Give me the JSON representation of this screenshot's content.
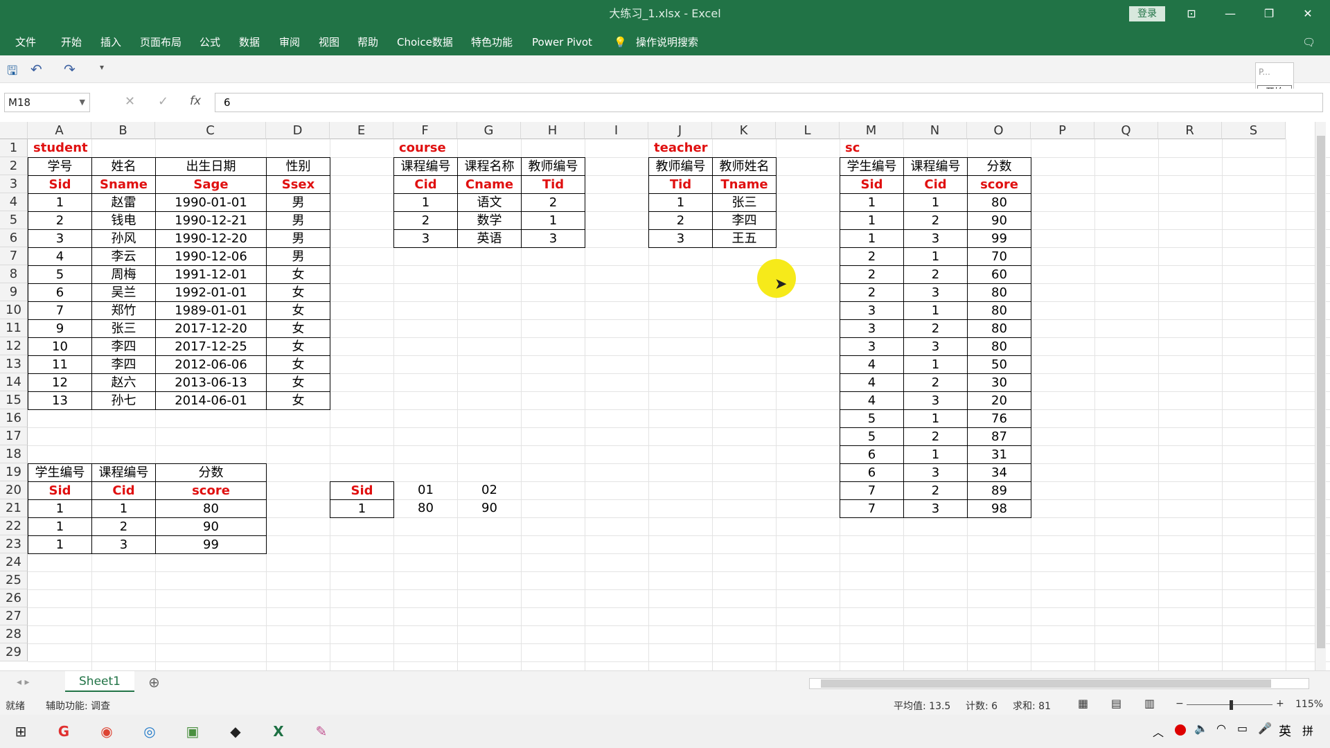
{
  "window": {
    "title": "大练习_1.xlsx - Excel",
    "login": "登录"
  },
  "menu": [
    "文件",
    "开始",
    "插入",
    "页面布局",
    "公式",
    "数据",
    "审阅",
    "视图",
    "帮助",
    "Choice数据",
    "特色功能",
    "Power Pivot",
    "操作说明搜索"
  ],
  "formula": {
    "namebox": "M18",
    "value": "6"
  },
  "mini": {
    "label": "P...",
    "button": "开始"
  },
  "columns": [
    "A",
    "B",
    "C",
    "D",
    "E",
    "F",
    "G",
    "H",
    "I",
    "J",
    "K",
    "L",
    "M",
    "N",
    "O",
    "P",
    "Q",
    "R",
    "S"
  ],
  "rows": [
    "1",
    "2",
    "3",
    "4",
    "5",
    "6",
    "7",
    "8",
    "9",
    "10",
    "11",
    "12",
    "13",
    "14",
    "15",
    "16",
    "17",
    "18",
    "19",
    "20",
    "21",
    "22",
    "23",
    "24",
    "25",
    "26",
    "27",
    "28",
    "29"
  ],
  "student": {
    "label": "student",
    "headers_cn": [
      "学号",
      "姓名",
      "出生日期",
      "性别"
    ],
    "headers_en": [
      "Sid",
      "Sname",
      "Sage",
      "Ssex"
    ],
    "rows": [
      [
        "1",
        "赵雷",
        "1990-01-01",
        "男"
      ],
      [
        "2",
        "钱电",
        "1990-12-21",
        "男"
      ],
      [
        "3",
        "孙风",
        "1990-12-20",
        "男"
      ],
      [
        "4",
        "李云",
        "1990-12-06",
        "男"
      ],
      [
        "5",
        "周梅",
        "1991-12-01",
        "女"
      ],
      [
        "6",
        "吴兰",
        "1992-01-01",
        "女"
      ],
      [
        "7",
        "郑竹",
        "1989-01-01",
        "女"
      ],
      [
        "9",
        "张三",
        "2017-12-20",
        "女"
      ],
      [
        "10",
        "李四",
        "2017-12-25",
        "女"
      ],
      [
        "11",
        "李四",
        "2012-06-06",
        "女"
      ],
      [
        "12",
        "赵六",
        "2013-06-13",
        "女"
      ],
      [
        "13",
        "孙七",
        "2014-06-01",
        "女"
      ]
    ]
  },
  "course": {
    "label": "course",
    "headers_cn": [
      "课程编号",
      "课程名称",
      "教师编号"
    ],
    "headers_en": [
      "Cid",
      "Cname",
      "Tid"
    ],
    "rows": [
      [
        "1",
        "语文",
        "2"
      ],
      [
        "2",
        "数学",
        "1"
      ],
      [
        "3",
        "英语",
        "3"
      ]
    ]
  },
  "teacher": {
    "label": "teacher",
    "headers_cn": [
      "教师编号",
      "教师姓名"
    ],
    "headers_en": [
      "Tid",
      "Tname"
    ],
    "rows": [
      [
        "1",
        "张三"
      ],
      [
        "2",
        "李四"
      ],
      [
        "3",
        "王五"
      ]
    ]
  },
  "sc": {
    "label": "sc",
    "headers_cn": [
      "学生编号",
      "课程编号",
      "分数"
    ],
    "headers_en": [
      "Sid",
      "Cid",
      "score"
    ],
    "rows": [
      [
        "1",
        "1",
        "80"
      ],
      [
        "1",
        "2",
        "90"
      ],
      [
        "1",
        "3",
        "99"
      ],
      [
        "2",
        "1",
        "70"
      ],
      [
        "2",
        "2",
        "60"
      ],
      [
        "2",
        "3",
        "80"
      ],
      [
        "3",
        "1",
        "80"
      ],
      [
        "3",
        "2",
        "80"
      ],
      [
        "3",
        "3",
        "80"
      ],
      [
        "4",
        "1",
        "50"
      ],
      [
        "4",
        "2",
        "30"
      ],
      [
        "4",
        "3",
        "20"
      ],
      [
        "5",
        "1",
        "76"
      ],
      [
        "5",
        "2",
        "87"
      ],
      [
        "6",
        "1",
        "31"
      ],
      [
        "6",
        "3",
        "34"
      ],
      [
        "7",
        "2",
        "89"
      ],
      [
        "7",
        "3",
        "98"
      ]
    ]
  },
  "sc_sub": {
    "headers_cn": [
      "学生编号",
      "课程编号",
      "分数"
    ],
    "headers_en": [
      "Sid",
      "Cid",
      "score"
    ],
    "rows": [
      [
        "1",
        "1",
        "80"
      ],
      [
        "1",
        "2",
        "90"
      ],
      [
        "1",
        "3",
        "99"
      ]
    ]
  },
  "pivot": {
    "header": [
      "Sid",
      "01",
      "02"
    ],
    "row": [
      "1",
      "80",
      "90"
    ]
  },
  "sheet": {
    "tab": "Sheet1",
    "add": "⊕"
  },
  "status": {
    "ready": "就绪",
    "accessibility": "辅助功能: 调查",
    "average": "平均值: 13.5",
    "count": "计数: 6",
    "sum": "求和: 81",
    "zoom": "115%"
  },
  "taskbar": {
    "ime": "英",
    "ime2": "拼"
  }
}
